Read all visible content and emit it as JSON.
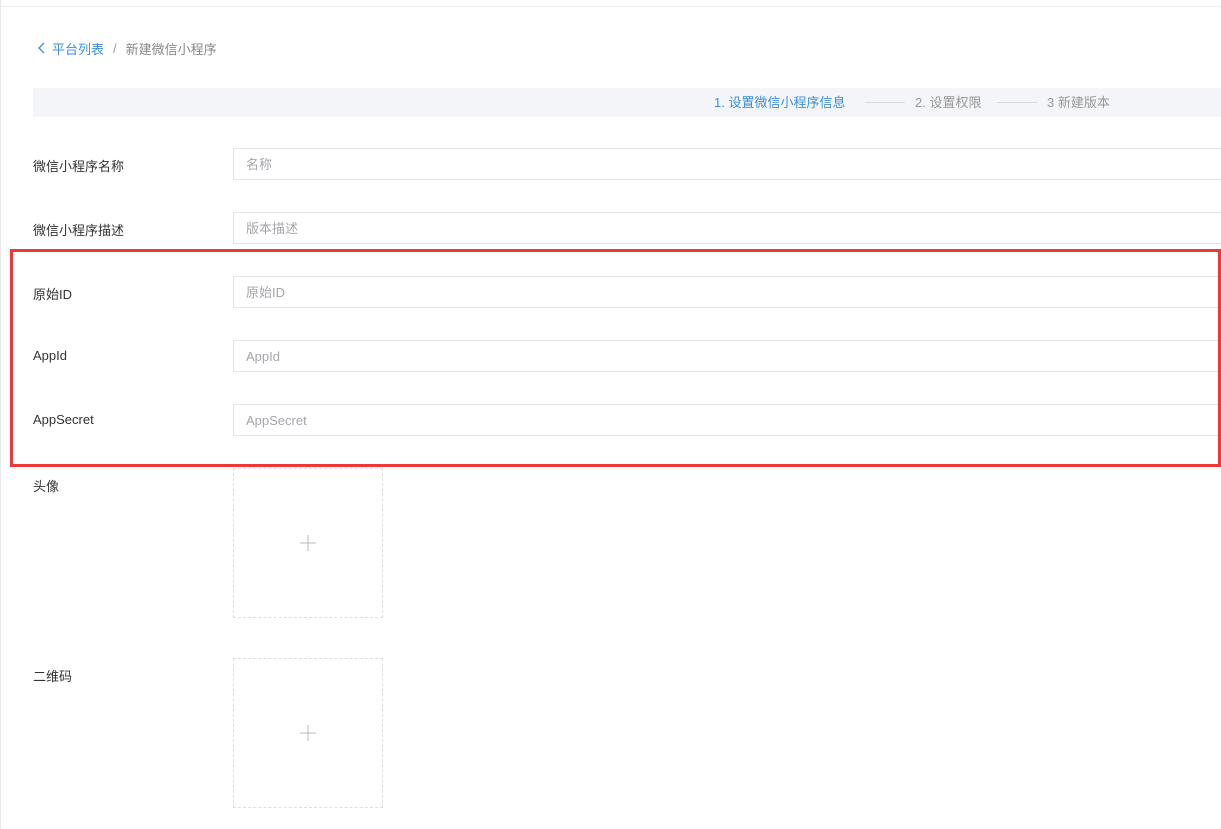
{
  "breadcrumb": {
    "back_label": "平台列表",
    "separator": "/",
    "current": "新建微信小程序"
  },
  "steps": [
    {
      "label": "1. 设置微信小程序信息",
      "active": true
    },
    {
      "label": "2. 设置权限",
      "active": false
    },
    {
      "label": "3 新建版本",
      "active": false
    }
  ],
  "form": {
    "name": {
      "label": "微信小程序名称",
      "placeholder": "名称",
      "value": ""
    },
    "description": {
      "label": "微信小程序描述",
      "placeholder": "版本描述",
      "value": ""
    },
    "original_id": {
      "label": "原始ID",
      "placeholder": "原始ID",
      "value": ""
    },
    "app_id": {
      "label": "AppId",
      "placeholder": "AppId",
      "value": ""
    },
    "app_secret": {
      "label": "AppSecret",
      "placeholder": "AppSecret",
      "value": ""
    },
    "avatar": {
      "label": "头像",
      "icon": "plus-icon"
    },
    "qrcode": {
      "label": "二维码",
      "icon": "plus-icon"
    }
  },
  "colors": {
    "accent": "#3b8fd9",
    "highlight": "#ef3737",
    "steps_background": "#f4f5f8"
  }
}
